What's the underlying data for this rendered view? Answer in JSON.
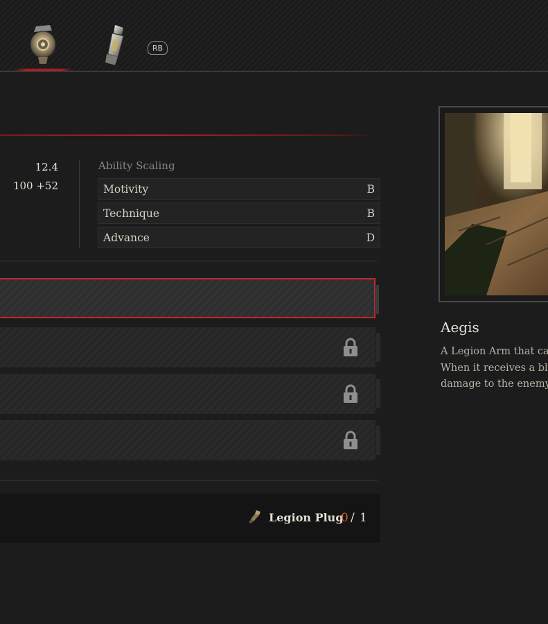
{
  "header": {
    "tabs": [
      {
        "icon": "legion-arm-aegis-icon",
        "active": true
      },
      {
        "icon": "legion-arm-alt-icon",
        "active": false
      }
    ],
    "next_button": "RB"
  },
  "stats": {
    "values": [
      "12.4",
      "100 +52"
    ]
  },
  "ability_scaling": {
    "title": "Ability Scaling",
    "rows": [
      {
        "label": "Motivity",
        "grade": "B"
      },
      {
        "label": "Technique",
        "grade": "B"
      },
      {
        "label": "Advance",
        "grade": "D"
      }
    ]
  },
  "slots": [
    {
      "locked": false,
      "selected": true
    },
    {
      "locked": true,
      "selected": false
    },
    {
      "locked": true,
      "selected": false
    },
    {
      "locked": true,
      "selected": false
    }
  ],
  "cost": {
    "material_icon": "legion-plug-icon",
    "label": "Legion Plug",
    "have": "0",
    "separator": "/",
    "need": "1"
  },
  "item": {
    "name": "Aegis",
    "description_lines": [
      "A Legion Arm that can",
      "When it receives a blow",
      "damage to the enemy."
    ]
  },
  "colors": {
    "accent_red": "#c7262a",
    "insufficient": "#d35f3a"
  }
}
